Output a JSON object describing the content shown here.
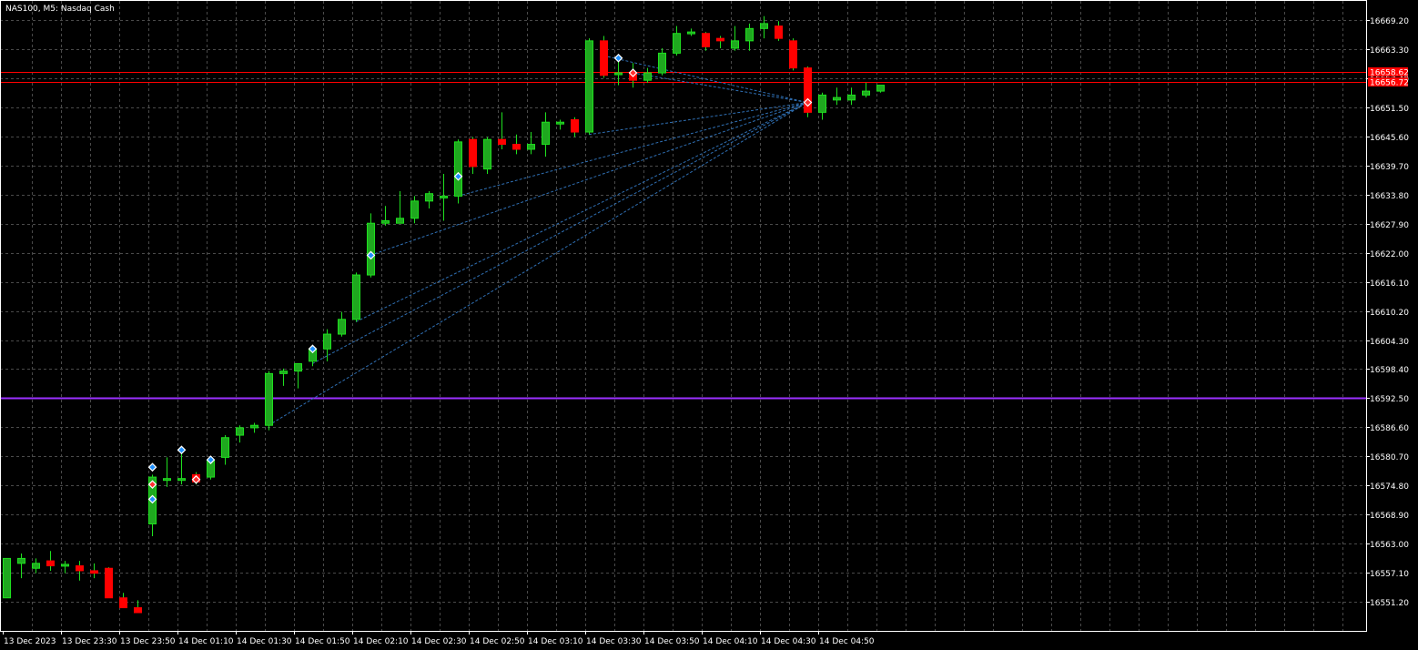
{
  "window": {
    "title": "NAS100, M5:  Nasdaq Cash"
  },
  "colors": {
    "background": "#000000",
    "grid": "#4a4a4a",
    "axis": "#ffffff",
    "bull": "#1fa81f",
    "bull_border": "#1fe01f",
    "bear": "#ff0000",
    "wick": "#1fe01f",
    "level_line": "#ff0000",
    "purple_line": "#9b30ff",
    "trend_line": "#2f6fb3",
    "price_tag_bg": "#ff0000"
  },
  "chart_data": {
    "type": "candlestick",
    "symbol": "NAS100",
    "timeframe": "M5",
    "title": "NAS100, M5:  Nasdaq Cash",
    "grid": true,
    "ylim": [
      16545.3,
      16673.1
    ],
    "y_ticks": [
      "16669.20",
      "16663.30",
      "16657.40",
      "16651.50",
      "16645.60",
      "16639.70",
      "16633.80",
      "16627.90",
      "16622.00",
      "16616.10",
      "16610.20",
      "16604.30",
      "16598.40",
      "16592.50",
      "16586.60",
      "16580.70",
      "16574.80",
      "16568.90",
      "16563.00",
      "16557.10",
      "16551.20"
    ],
    "y_tick_values": [
      16669.2,
      16663.3,
      16657.4,
      16651.5,
      16645.6,
      16639.7,
      16633.8,
      16627.9,
      16622.0,
      16616.1,
      16610.2,
      16604.3,
      16598.4,
      16592.5,
      16586.6,
      16580.7,
      16574.8,
      16568.9,
      16563.0,
      16557.1,
      16551.2
    ],
    "x_ticks": [
      "13 Dec 2023",
      "13 Dec 23:30",
      "13 Dec 23:50",
      "14 Dec 01:10",
      "14 Dec 01:30",
      "14 Dec 01:50",
      "14 Dec 02:10",
      "14 Dec 02:30",
      "14 Dec 02:50",
      "14 Dec 03:10",
      "14 Dec 03:30",
      "14 Dec 03:50",
      "14 Dec 04:10",
      "14 Dec 04:30",
      "14 Dec 04:50"
    ],
    "candles": [
      {
        "o": 16552.0,
        "h": 16560.0,
        "l": 16552.0,
        "c": 16560.0
      },
      {
        "o": 16559.0,
        "h": 16561.0,
        "l": 16556.0,
        "c": 16560.0
      },
      {
        "o": 16558.0,
        "h": 16560.0,
        "l": 16557.0,
        "c": 16559.0
      },
      {
        "o": 16559.5,
        "h": 16561.5,
        "l": 16557.5,
        "c": 16558.5
      },
      {
        "o": 16558.5,
        "h": 16559.5,
        "l": 16557.0,
        "c": 16558.8
      },
      {
        "o": 16558.5,
        "h": 16559.5,
        "l": 16555.5,
        "c": 16557.5
      },
      {
        "o": 16557.5,
        "h": 16559.0,
        "l": 16556.0,
        "c": 16557.0
      },
      {
        "o": 16558.0,
        "h": 16558.2,
        "l": 16552.0,
        "c": 16552.0
      },
      {
        "o": 16552.0,
        "h": 16553.0,
        "l": 16550.0,
        "c": 16550.0
      },
      {
        "o": 16550.0,
        "h": 16551.5,
        "l": 16549.0,
        "c": 16549.0
      },
      {
        "o": 16567.0,
        "h": 16577.0,
        "l": 16564.5,
        "c": 16576.5
      },
      {
        "o": 16576.0,
        "h": 16580.5,
        "l": 16574.5,
        "c": 16576.2
      },
      {
        "o": 16576.0,
        "h": 16582.0,
        "l": 16575.0,
        "c": 16576.2
      },
      {
        "o": 16577.0,
        "h": 16577.5,
        "l": 16575.0,
        "c": 16575.5
      },
      {
        "o": 16576.5,
        "h": 16580.0,
        "l": 16576.0,
        "c": 16580.0
      },
      {
        "o": 16580.5,
        "h": 16585.0,
        "l": 16579.0,
        "c": 16584.5
      },
      {
        "o": 16585.0,
        "h": 16587.0,
        "l": 16583.5,
        "c": 16586.5
      },
      {
        "o": 16586.5,
        "h": 16587.5,
        "l": 16585.5,
        "c": 16587.0
      },
      {
        "o": 16587.0,
        "h": 16598.0,
        "l": 16586.0,
        "c": 16597.5
      },
      {
        "o": 16597.5,
        "h": 16598.5,
        "l": 16595.0,
        "c": 16598.0
      },
      {
        "o": 16598.0,
        "h": 16599.5,
        "l": 16594.5,
        "c": 16599.5
      },
      {
        "o": 16600.0,
        "h": 16603.0,
        "l": 16599.0,
        "c": 16602.5
      },
      {
        "o": 16602.5,
        "h": 16606.5,
        "l": 16600.0,
        "c": 16605.5
      },
      {
        "o": 16605.5,
        "h": 16610.0,
        "l": 16605.0,
        "c": 16608.5
      },
      {
        "o": 16608.5,
        "h": 16618.0,
        "l": 16608.0,
        "c": 16617.5
      },
      {
        "o": 16617.5,
        "h": 16630.0,
        "l": 16617.0,
        "c": 16628.0
      },
      {
        "o": 16628.0,
        "h": 16631.5,
        "l": 16627.5,
        "c": 16628.5
      },
      {
        "o": 16628.0,
        "h": 16634.5,
        "l": 16628.0,
        "c": 16629.0
      },
      {
        "o": 16629.0,
        "h": 16633.5,
        "l": 16628.0,
        "c": 16632.5
      },
      {
        "o": 16632.5,
        "h": 16634.5,
        "l": 16631.0,
        "c": 16634.0
      },
      {
        "o": 16633.5,
        "h": 16638.0,
        "l": 16628.5,
        "c": 16633.5
      },
      {
        "o": 16633.5,
        "h": 16645.0,
        "l": 16632.0,
        "c": 16644.5
      },
      {
        "o": 16645.0,
        "h": 16645.5,
        "l": 16638.0,
        "c": 16639.5
      },
      {
        "o": 16639.0,
        "h": 16645.5,
        "l": 16638.0,
        "c": 16645.0
      },
      {
        "o": 16645.0,
        "h": 16650.5,
        "l": 16643.0,
        "c": 16644.0
      },
      {
        "o": 16644.0,
        "h": 16646.0,
        "l": 16642.0,
        "c": 16643.0
      },
      {
        "o": 16643.0,
        "h": 16646.5,
        "l": 16642.0,
        "c": 16644.0
      },
      {
        "o": 16644.0,
        "h": 16650.5,
        "l": 16641.5,
        "c": 16648.5
      },
      {
        "o": 16648.5,
        "h": 16649.0,
        "l": 16647.0,
        "c": 16648.5
      },
      {
        "o": 16649.0,
        "h": 16649.5,
        "l": 16645.5,
        "c": 16646.5
      },
      {
        "o": 16646.5,
        "h": 16665.5,
        "l": 16646.0,
        "c": 16665.0
      },
      {
        "o": 16665.0,
        "h": 16666.0,
        "l": 16657.5,
        "c": 16658.0
      },
      {
        "o": 16658.5,
        "h": 16662.0,
        "l": 16656.0,
        "c": 16658.5
      },
      {
        "o": 16658.5,
        "h": 16660.5,
        "l": 16655.5,
        "c": 16657.0
      },
      {
        "o": 16657.0,
        "h": 16659.5,
        "l": 16656.5,
        "c": 16658.5
      },
      {
        "o": 16658.5,
        "h": 16663.5,
        "l": 16658.0,
        "c": 16662.5
      },
      {
        "o": 16662.5,
        "h": 16668.0,
        "l": 16662.0,
        "c": 16666.5
      },
      {
        "o": 16666.5,
        "h": 16667.5,
        "l": 16666.0,
        "c": 16666.8
      },
      {
        "o": 16666.5,
        "h": 16666.8,
        "l": 16663.0,
        "c": 16663.8
      },
      {
        "o": 16665.5,
        "h": 16666.0,
        "l": 16663.5,
        "c": 16665.0
      },
      {
        "o": 16663.5,
        "h": 16668.0,
        "l": 16663.0,
        "c": 16665.0
      },
      {
        "o": 16665.0,
        "h": 16668.5,
        "l": 16663.0,
        "c": 16667.5
      },
      {
        "o": 16667.5,
        "h": 16670.0,
        "l": 16665.5,
        "c": 16668.5
      },
      {
        "o": 16668.0,
        "h": 16669.0,
        "l": 16665.0,
        "c": 16665.5
      },
      {
        "o": 16665.0,
        "h": 16665.5,
        "l": 16659.0,
        "c": 16659.5
      },
      {
        "o": 16659.5,
        "h": 16659.8,
        "l": 16649.5,
        "c": 16650.5
      },
      {
        "o": 16650.5,
        "h": 16654.5,
        "l": 16649.0,
        "c": 16654.0
      },
      {
        "o": 16653.0,
        "h": 16655.5,
        "l": 16652.0,
        "c": 16653.5
      },
      {
        "o": 16653.0,
        "h": 16655.5,
        "l": 16652.0,
        "c": 16654.0
      },
      {
        "o": 16654.0,
        "h": 16656.5,
        "l": 16653.5,
        "c": 16654.8
      },
      {
        "o": 16654.8,
        "h": 16656.0,
        "l": 16654.5,
        "c": 16656.0
      }
    ],
    "price_levels": [
      {
        "label": "16658.62",
        "value": 16658.62
      },
      {
        "label": "16656.72",
        "value": 16656.72
      }
    ],
    "horizontal_line": {
      "value": 16592.5
    },
    "trend_lines": [
      {
        "from": {
          "i": 18,
          "p": 16587.0
        },
        "to": {
          "i": 55,
          "p": 16652.5
        }
      },
      {
        "from": {
          "i": 24,
          "p": 16608.0
        },
        "to": {
          "i": 55,
          "p": 16652.5
        }
      },
      {
        "from": {
          "i": 25,
          "p": 16621.5
        },
        "to": {
          "i": 55,
          "p": 16652.5
        }
      },
      {
        "from": {
          "i": 31,
          "p": 16633.5
        },
        "to": {
          "i": 55,
          "p": 16652.5
        }
      },
      {
        "from": {
          "i": 40,
          "p": 16646.0
        },
        "to": {
          "i": 55,
          "p": 16652.5
        }
      },
      {
        "from": {
          "i": 41,
          "p": 16662.0
        },
        "to": {
          "i": 55,
          "p": 16652.5
        }
      },
      {
        "from": {
          "i": 43,
          "p": 16658.5
        },
        "to": {
          "i": 55,
          "p": 16652.5
        }
      },
      {
        "from": {
          "i": 21,
          "p": 16599.5
        },
        "to": {
          "i": 55,
          "p": 16652.5
        }
      }
    ],
    "markers": [
      {
        "i": 10,
        "p": 16578.5,
        "kind": "buy"
      },
      {
        "i": 10,
        "p": 16572.0,
        "kind": "buy"
      },
      {
        "i": 10,
        "p": 16575.0,
        "kind": "sell"
      },
      {
        "i": 12,
        "p": 16582.0,
        "kind": "buy"
      },
      {
        "i": 13,
        "p": 16576.0,
        "kind": "sell"
      },
      {
        "i": 14,
        "p": 16580.0,
        "kind": "buy"
      },
      {
        "i": 21,
        "p": 16602.5,
        "kind": "buy"
      },
      {
        "i": 25,
        "p": 16621.5,
        "kind": "buy"
      },
      {
        "i": 31,
        "p": 16637.5,
        "kind": "buy"
      },
      {
        "i": 42,
        "p": 16661.5,
        "kind": "buy"
      },
      {
        "i": 43,
        "p": 16658.5,
        "kind": "sell"
      },
      {
        "i": 55,
        "p": 16652.5,
        "kind": "sell"
      }
    ]
  }
}
